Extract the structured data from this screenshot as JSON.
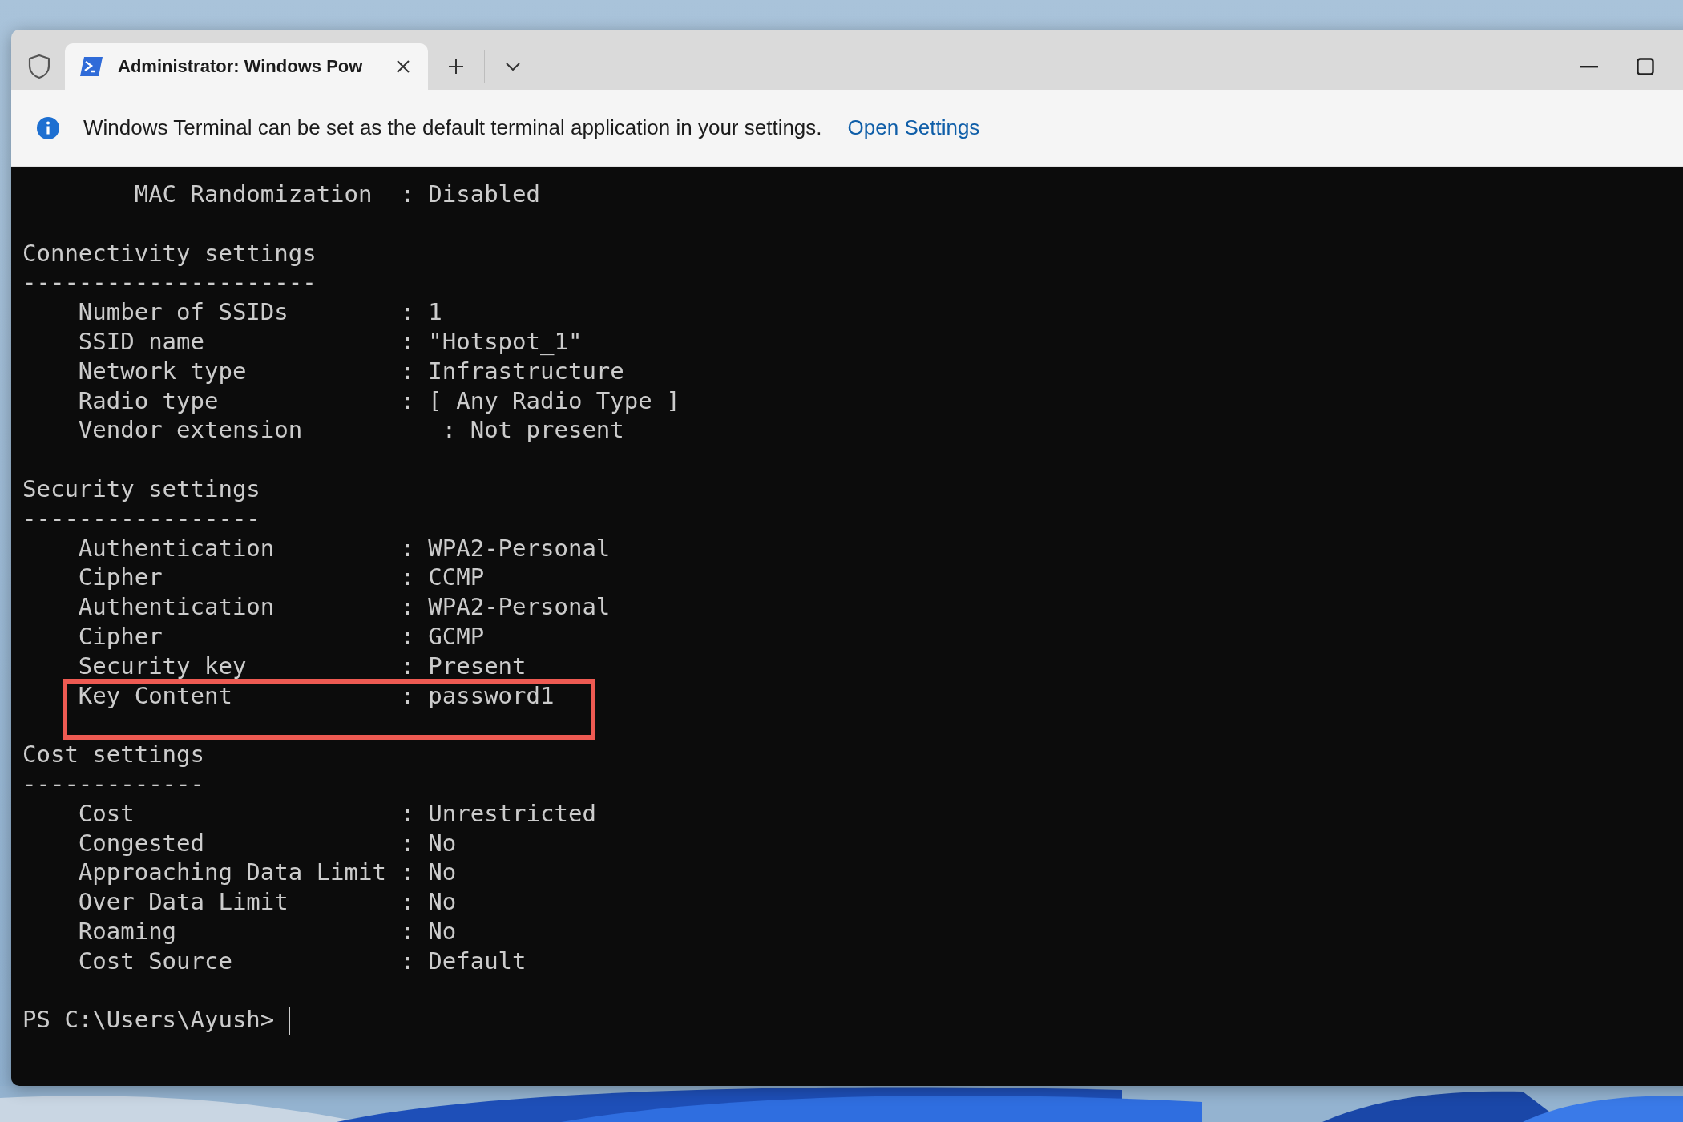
{
  "tab_bar": {
    "tabs": [
      {
        "title": "Administrator: Windows Pow",
        "selected": true
      }
    ]
  },
  "info_bar": {
    "message": "Windows Terminal can be set as the default terminal application in your settings.",
    "link": "Open Settings"
  },
  "terminal": {
    "lines": [
      {
        "kind": "text",
        "text": "        MAC Randomization  : Disabled",
        "highlighted": false
      },
      {
        "kind": "blank"
      },
      {
        "kind": "text",
        "text": "Connectivity settings",
        "highlighted": false
      },
      {
        "kind": "text",
        "text": "---------------------",
        "highlighted": false
      },
      {
        "kind": "text",
        "text": "    Number of SSIDs        : 1",
        "highlighted": false
      },
      {
        "kind": "text",
        "text": "    SSID name              : \"Hotspot_1\"",
        "highlighted": false
      },
      {
        "kind": "text",
        "text": "    Network type           : Infrastructure",
        "highlighted": false
      },
      {
        "kind": "text",
        "text": "    Radio type             : [ Any Radio Type ]",
        "highlighted": false
      },
      {
        "kind": "text",
        "text": "    Vendor extension          : Not present",
        "highlighted": false
      },
      {
        "kind": "blank"
      },
      {
        "kind": "text",
        "text": "Security settings",
        "highlighted": false
      },
      {
        "kind": "text",
        "text": "-----------------",
        "highlighted": false
      },
      {
        "kind": "text",
        "text": "    Authentication         : WPA2-Personal",
        "highlighted": false
      },
      {
        "kind": "text",
        "text": "    Cipher                 : CCMP",
        "highlighted": false
      },
      {
        "kind": "text",
        "text": "    Authentication         : WPA2-Personal",
        "highlighted": false
      },
      {
        "kind": "text",
        "text": "    Cipher                 : GCMP",
        "highlighted": false
      },
      {
        "kind": "text",
        "text": "    Security key           : Present",
        "highlighted": false
      },
      {
        "kind": "text",
        "text": "    Key Content            : password1",
        "highlighted": true
      },
      {
        "kind": "blank"
      },
      {
        "kind": "text",
        "text": "Cost settings",
        "highlighted": false
      },
      {
        "kind": "text",
        "text": "-------------",
        "highlighted": false
      },
      {
        "kind": "text",
        "text": "    Cost                   : Unrestricted",
        "highlighted": false
      },
      {
        "kind": "text",
        "text": "    Congested              : No",
        "highlighted": false
      },
      {
        "kind": "text",
        "text": "    Approaching Data Limit : No",
        "highlighted": false
      },
      {
        "kind": "text",
        "text": "    Over Data Limit        : No",
        "highlighted": false
      },
      {
        "kind": "text",
        "text": "    Roaming                : No",
        "highlighted": false
      },
      {
        "kind": "text",
        "text": "    Cost Source            : Default",
        "highlighted": false
      },
      {
        "kind": "blank"
      }
    ],
    "prompt": "PS C:\\Users\\Ayush>"
  }
}
